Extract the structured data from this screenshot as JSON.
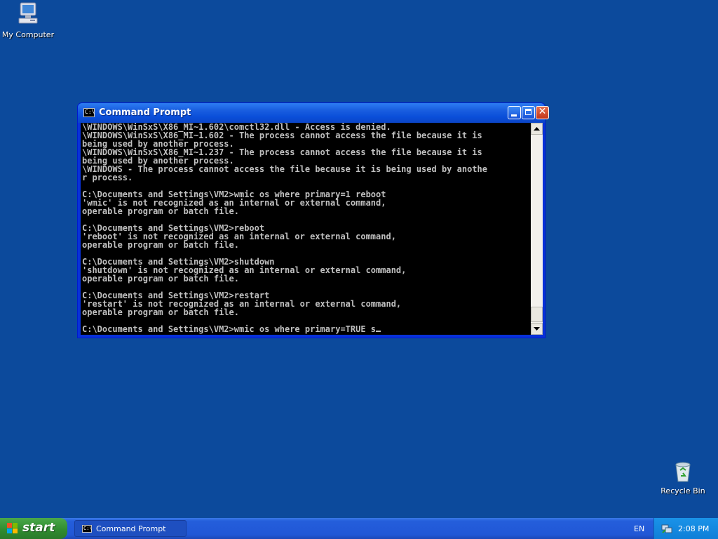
{
  "desktop": {
    "icons": [
      {
        "label": "My Computer"
      },
      {
        "label": "Recycle Bin"
      }
    ]
  },
  "window": {
    "title": "Command Prompt",
    "console_text": "\\WINDOWS\\WinSxS\\X86_MI~1.602\\comctl32.dll - Access is denied.\n\\WINDOWS\\WinSxS\\X86_MI~1.602 - The process cannot access the file because it is\nbeing used by another process.\n\\WINDOWS\\WinSxS\\X86_MI~1.237 - The process cannot access the file because it is\nbeing used by another process.\n\\WINDOWS - The process cannot access the file because it is being used by anothe\nr process.\n\nC:\\Documents and Settings\\VM2>wmic os where primary=1 reboot\n'wmic' is not recognized as an internal or external command,\noperable program or batch file.\n\nC:\\Documents and Settings\\VM2>reboot\n'reboot' is not recognized as an internal or external command,\noperable program or batch file.\n\nC:\\Documents and Settings\\VM2>shutdown\n'shutdown' is not recognized as an internal or external command,\noperable program or batch file.\n\nC:\\Documents and Settings\\VM2>restart\n'restart' is not recognized as an internal or external command,\noperable program or batch file.\n\nC:\\Documents and Settings\\VM2>wmic os where primary=TRUE s",
    "console_icon_text": "C:\\"
  },
  "taskbar": {
    "start_label": "start",
    "tasks": [
      {
        "label": "Command Prompt"
      }
    ],
    "language": "EN",
    "clock": "2:08 PM"
  },
  "colors": {
    "desktop": "#0c4a9c",
    "console_bg": "#000000",
    "console_fg": "#c0c0c0",
    "titlebar": "#0a4ed9",
    "start": "#2f8a2f"
  }
}
